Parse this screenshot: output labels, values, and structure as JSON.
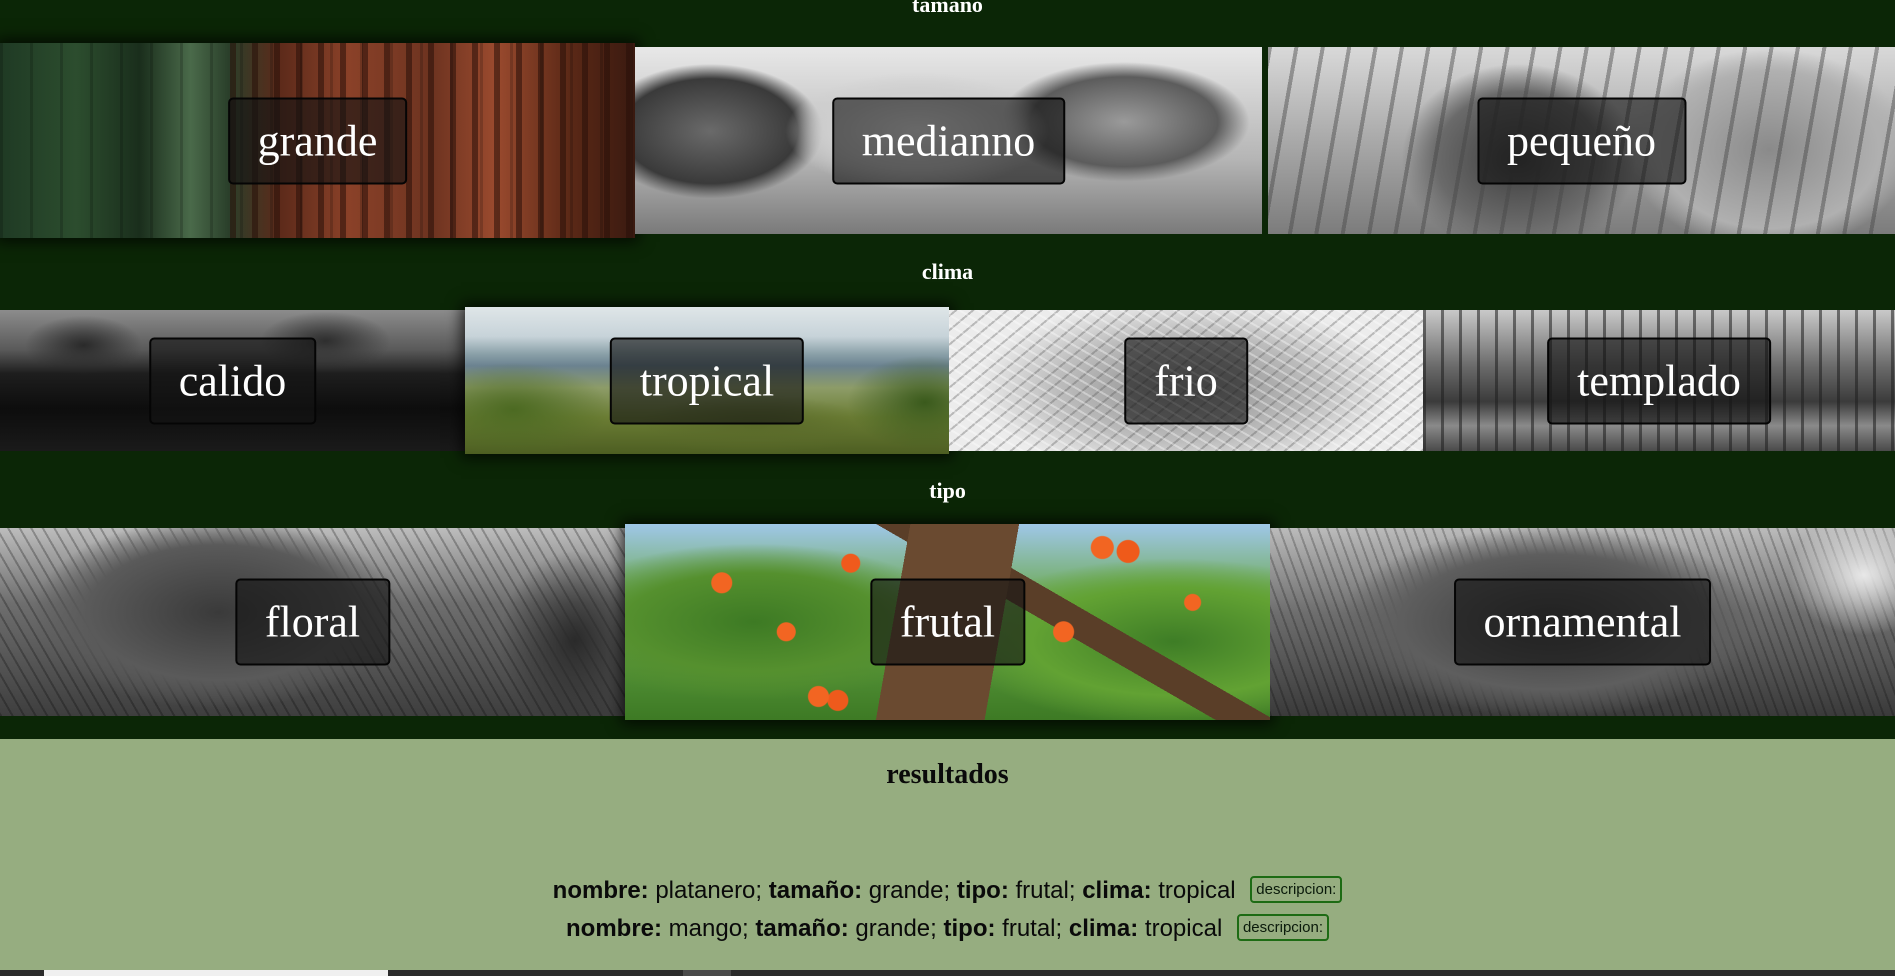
{
  "sections": {
    "size": {
      "heading": "tamaño",
      "options": [
        "grande",
        "medianno",
        "pequeño"
      ]
    },
    "climate": {
      "heading": "clima",
      "options": [
        "calido",
        "tropical",
        "frio",
        "templado"
      ]
    },
    "type": {
      "heading": "tipo",
      "options": [
        "floral",
        "frutal",
        "ornamental"
      ]
    }
  },
  "results": {
    "title": "resultados",
    "field_labels": {
      "name": "nombre:",
      "size": "tamaño:",
      "type": "tipo:",
      "climate": "clima:"
    },
    "items": [
      {
        "name": "platanero;",
        "size": "grande;",
        "type": "frutal;",
        "climate": "tropical",
        "button": "descripcion:"
      },
      {
        "name": "mango;",
        "size": "grande;",
        "type": "frutal;",
        "climate": "tropical",
        "button": "descripcion:"
      }
    ]
  },
  "colors": {
    "page_background": "#0b2606",
    "results_background": "#96ad80",
    "button_border": "#1d6b14",
    "fruit_orange": "#f26522"
  }
}
